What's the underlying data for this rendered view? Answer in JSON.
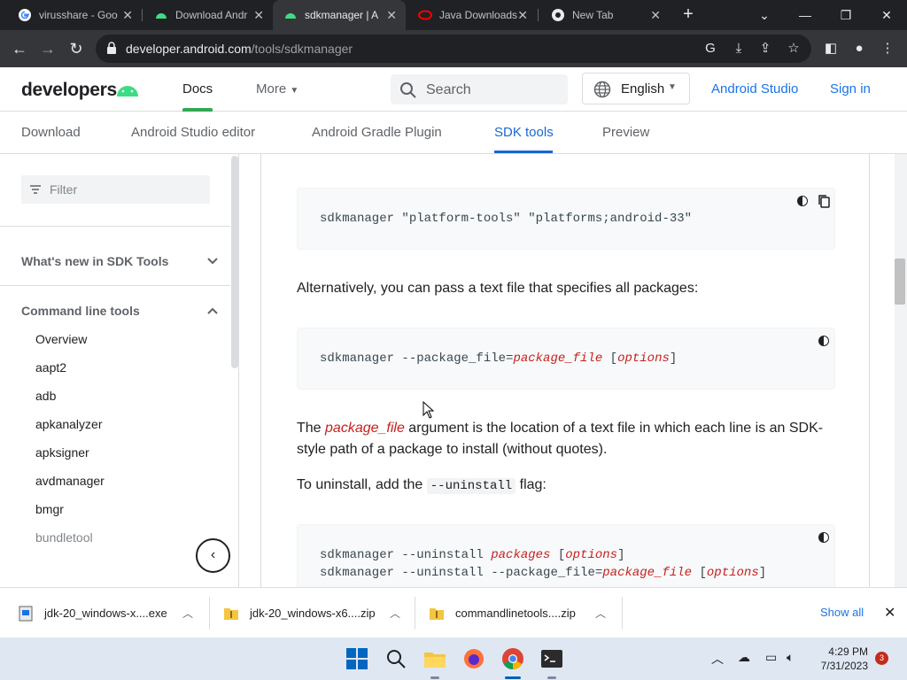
{
  "browser": {
    "tabs": [
      {
        "title": "virusshare - Goo",
        "active": false,
        "icon": "google-icon"
      },
      {
        "title": "Download Andr",
        "active": false,
        "icon": "android-icon"
      },
      {
        "title": "sdkmanager | A",
        "active": true,
        "icon": "android-icon"
      },
      {
        "title": "Java Downloads",
        "active": false,
        "icon": "oracle-icon"
      },
      {
        "title": "New Tab",
        "active": false,
        "icon": "chrome-icon"
      }
    ],
    "url_host": "developer.android.com",
    "url_path": "/tools/sdkmanager"
  },
  "site_header": {
    "logo": "developers",
    "docs_label": "Docs",
    "more_label": "More",
    "search_placeholder": "Search",
    "language": "English",
    "android_studio": "Android Studio",
    "sign_in": "Sign in"
  },
  "subnav": {
    "items": [
      "Download",
      "Android Studio editor",
      "Android Gradle Plugin",
      "SDK tools",
      "Preview"
    ],
    "active": "SDK tools"
  },
  "sidebar": {
    "filter_placeholder": "Filter",
    "section1": "What's new in SDK Tools",
    "section2": "Command line tools",
    "items": [
      "Overview",
      "aapt2",
      "adb",
      "apkanalyzer",
      "apksigner",
      "avdmanager",
      "bmgr",
      "bundletool"
    ]
  },
  "content": {
    "code1": "sdkmanager \"platform-tools\" \"platforms;android-33\"",
    "para1": "Alternatively, you can pass a text file that specifies all packages:",
    "code2_prefix": "sdkmanager --package_file=",
    "code2_var": "package_file",
    "code2_open": " [",
    "code2_opt": "options",
    "code2_close": "]",
    "para2_pre": "The ",
    "para2_var": "package_file",
    "para2_post": " argument is the location of a text file in which each line is an SDK-style path of a package to install (without quotes).",
    "para3_pre": "To uninstall, add the ",
    "para3_code": "--uninstall",
    "para3_post": " flag:",
    "code3_l1_prefix": "sdkmanager --uninstall ",
    "code3_l1_var": "packages",
    "code3_l1_open": " [",
    "code3_l1_opt": "options",
    "code3_l1_close": "]",
    "code3_l2_prefix": "sdkmanager --uninstall --package_file=",
    "code3_l2_var": "package_file",
    "code3_l2_open": " [",
    "code3_l2_opt": "options",
    "code3_l2_close": "]"
  },
  "downloads": {
    "items": [
      "jdk-20_windows-x....exe",
      "jdk-20_windows-x6....zip",
      "commandlinetools....zip"
    ],
    "show_all": "Show all"
  },
  "taskbar": {
    "time": "4:29 PM",
    "date": "7/31/2023",
    "notifications": "3"
  }
}
